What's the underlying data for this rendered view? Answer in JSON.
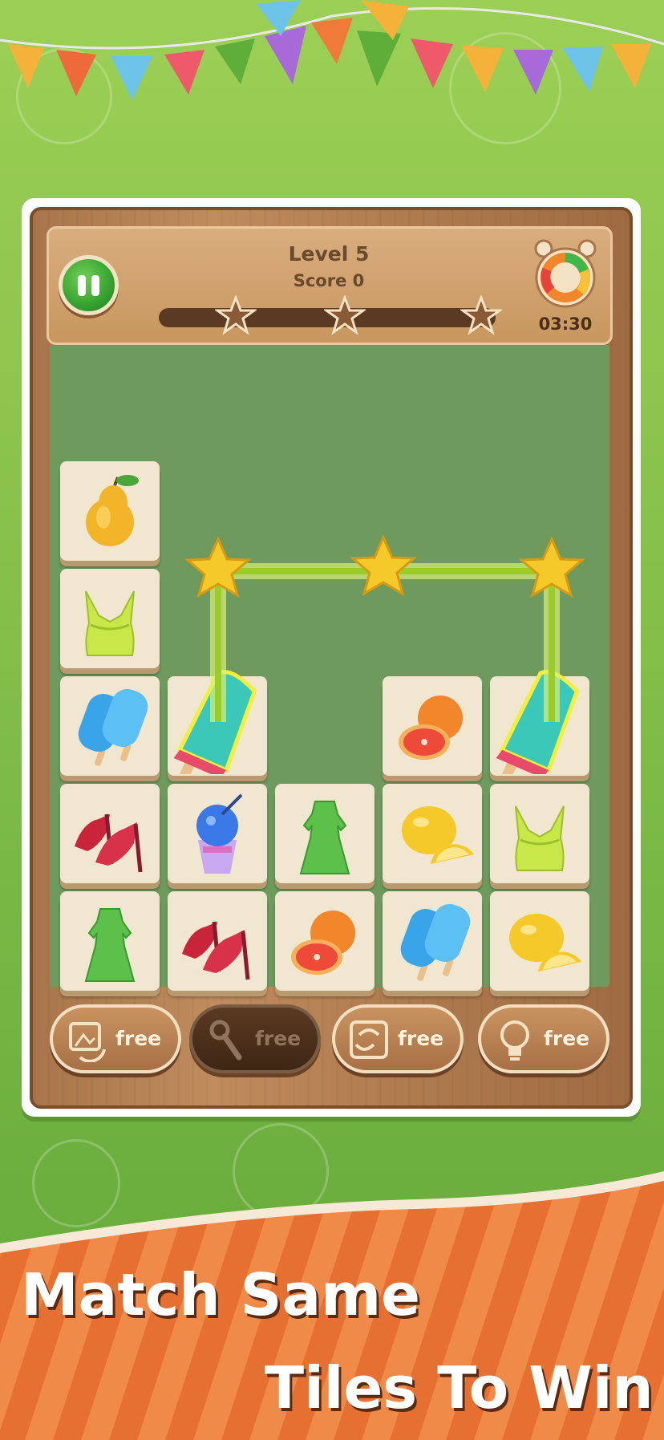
{
  "header": {
    "level_text": "Level 5",
    "score_text": "Score 0",
    "timer_text": "03:30",
    "stars_earned": 0,
    "stars_total": 3
  },
  "tiles": [
    {
      "row": 0,
      "col": 0,
      "item": "pear"
    },
    {
      "row": 1,
      "col": 0,
      "item": "green-top"
    },
    {
      "row": 2,
      "col": 0,
      "item": "blue-popsicle"
    },
    {
      "row": 2,
      "col": 1,
      "item": "teal-popsicle",
      "selected": true
    },
    {
      "row": 2,
      "col": 3,
      "item": "grapefruit"
    },
    {
      "row": 2,
      "col": 4,
      "item": "teal-popsicle",
      "selected": true
    },
    {
      "row": 3,
      "col": 0,
      "item": "red-heels"
    },
    {
      "row": 3,
      "col": 1,
      "item": "snow-cone"
    },
    {
      "row": 3,
      "col": 2,
      "item": "green-dress"
    },
    {
      "row": 3,
      "col": 3,
      "item": "lemon"
    },
    {
      "row": 3,
      "col": 4,
      "item": "green-top"
    },
    {
      "row": 4,
      "col": 0,
      "item": "green-dress"
    },
    {
      "row": 4,
      "col": 1,
      "item": "red-heels"
    },
    {
      "row": 4,
      "col": 2,
      "item": "grapefruit"
    },
    {
      "row": 4,
      "col": 3,
      "item": "blue-popsicle"
    },
    {
      "row": 4,
      "col": 4,
      "item": "lemon"
    }
  ],
  "tools": [
    {
      "name": "shuffle-icon",
      "label": "free",
      "enabled": true
    },
    {
      "name": "wrench-icon",
      "label": "free",
      "enabled": false
    },
    {
      "name": "swap-icon",
      "label": "free",
      "enabled": true
    },
    {
      "name": "hint-bulb-icon",
      "label": "free",
      "enabled": true
    }
  ],
  "slogan": {
    "line1": "Match Same",
    "line2": "Tiles To Win"
  },
  "colors": {
    "background_green": "#86c04a",
    "board_wood": "#b07c50",
    "banner_orange": "#ec7a3a",
    "link_glow": "#b7e04a"
  }
}
